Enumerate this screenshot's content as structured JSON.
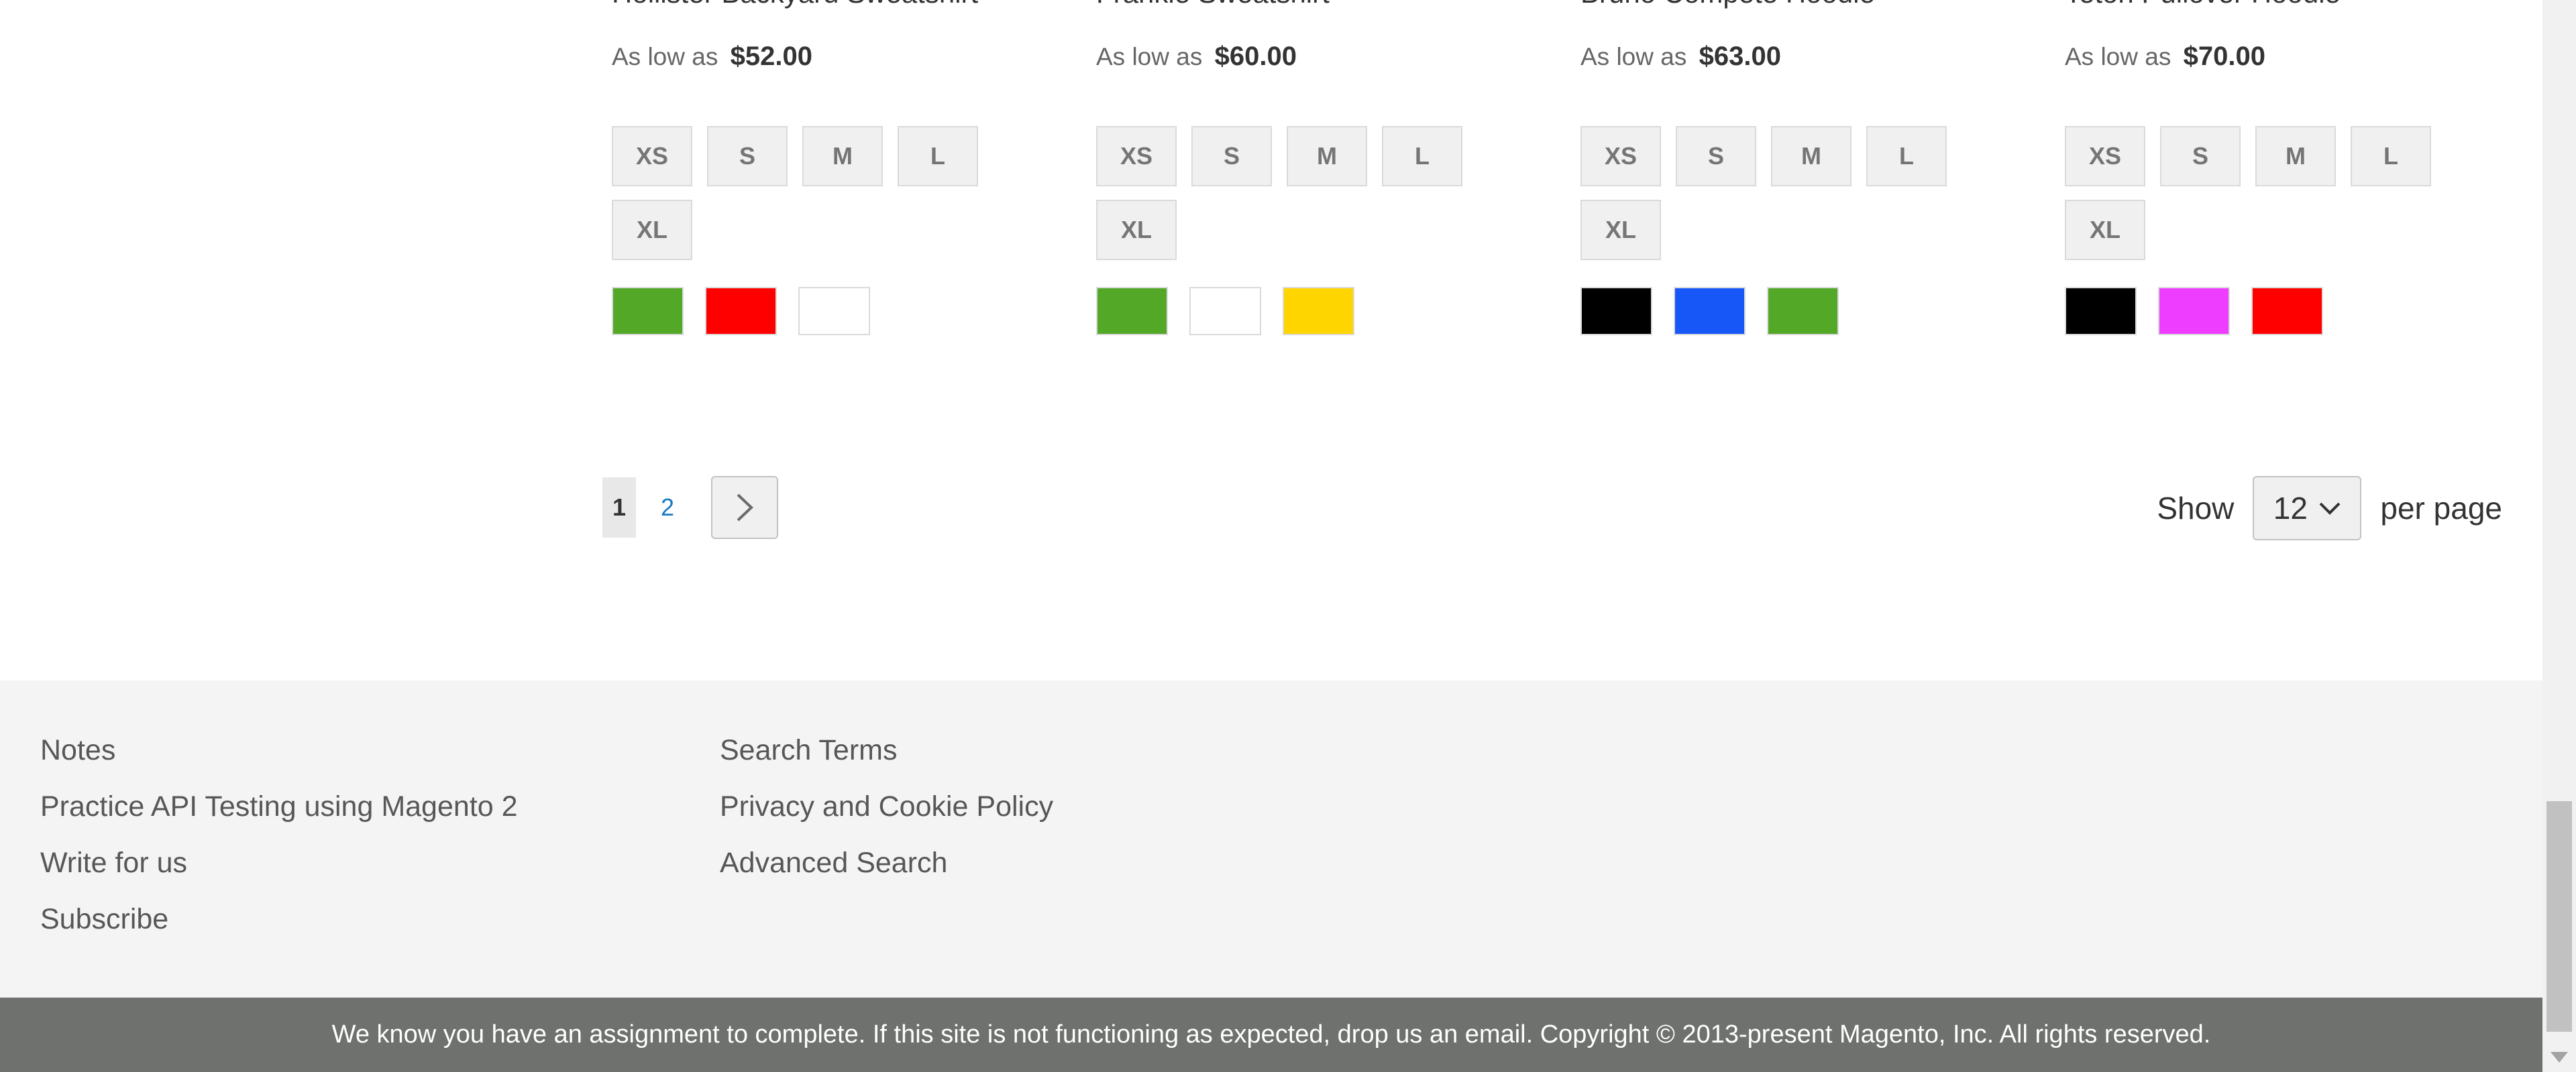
{
  "products": [
    {
      "name": "Hollister Backyard Sweatshirt",
      "price_prefix": "As low as",
      "price": "$52.00",
      "sizes": [
        "XS",
        "S",
        "M",
        "L",
        "XL"
      ],
      "colors": [
        {
          "name": "Green",
          "hex": "#53a828"
        },
        {
          "name": "Red",
          "hex": "#ff0000"
        },
        {
          "name": "White",
          "hex": "#ffffff"
        }
      ]
    },
    {
      "name": "Frankie Sweatshirt",
      "price_prefix": "As low as",
      "price": "$60.00",
      "sizes": [
        "XS",
        "S",
        "M",
        "L",
        "XL"
      ],
      "colors": [
        {
          "name": "Green",
          "hex": "#53a828"
        },
        {
          "name": "White",
          "hex": "#ffffff"
        },
        {
          "name": "Yellow",
          "hex": "#ffd500"
        }
      ]
    },
    {
      "name": "Bruno Compete Hoodie",
      "price_prefix": "As low as",
      "price": "$63.00",
      "sizes": [
        "XS",
        "S",
        "M",
        "L",
        "XL"
      ],
      "colors": [
        {
          "name": "Black",
          "hex": "#000000"
        },
        {
          "name": "Blue",
          "hex": "#1857f7"
        },
        {
          "name": "Green",
          "hex": "#53a828"
        }
      ]
    },
    {
      "name": "Teton Pullover Hoodie",
      "price_prefix": "As low as",
      "price": "$70.00",
      "sizes": [
        "XS",
        "S",
        "M",
        "L",
        "XL"
      ],
      "colors": [
        {
          "name": "Black",
          "hex": "#000000"
        },
        {
          "name": "Purple",
          "hex": "#ef3dff"
        },
        {
          "name": "Red",
          "hex": "#ff0000"
        }
      ]
    }
  ],
  "pager": {
    "current": "1",
    "pages": [
      "2"
    ],
    "next_icon": "chevron-right-icon"
  },
  "limiter": {
    "show_label": "Show",
    "value": "12",
    "per_page_label": "per page",
    "dropdown_icon": "chevron-down-icon"
  },
  "footer": {
    "col1": [
      "Notes",
      "Practice API Testing using Magento 2",
      "Write for us",
      "Subscribe"
    ],
    "col2": [
      "Search Terms",
      "Privacy and Cookie Policy",
      "Advanced Search"
    ]
  },
  "copyright": "We know you have an assignment to complete. If this site is not functioning as expected, drop us an email. Copyright © 2013-present Magento, Inc. All rights reserved."
}
